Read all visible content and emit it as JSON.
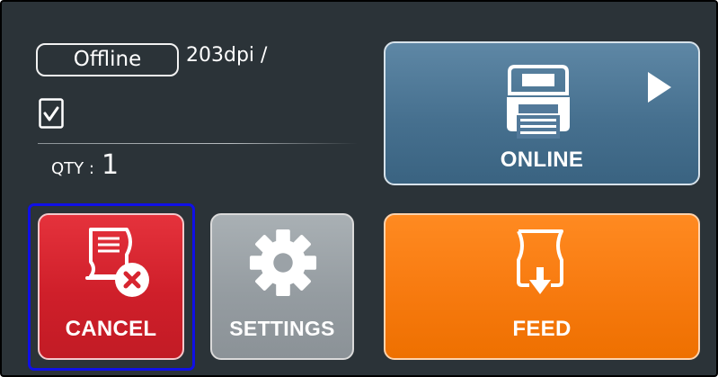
{
  "status": {
    "mode_badge": "Offline",
    "resolution": "203dpi /",
    "quantity_label": "QTY :",
    "quantity_value": "1",
    "check_icon": "check-icon"
  },
  "buttons": {
    "online": {
      "label": "ONLINE",
      "icon": "printer-icon",
      "arrow_icon": "play-arrow-icon",
      "color": "#4f7898"
    },
    "cancel": {
      "label": "CANCEL",
      "icon": "cancel-document-icon",
      "color": "#d72530"
    },
    "settings": {
      "label": "SETTINGS",
      "icon": "gear-icon",
      "color": "#9ba2a7"
    },
    "feed": {
      "label": "FEED",
      "icon": "feed-paper-icon",
      "color": "#f77a0f"
    }
  },
  "focus_color": "#1010e6"
}
